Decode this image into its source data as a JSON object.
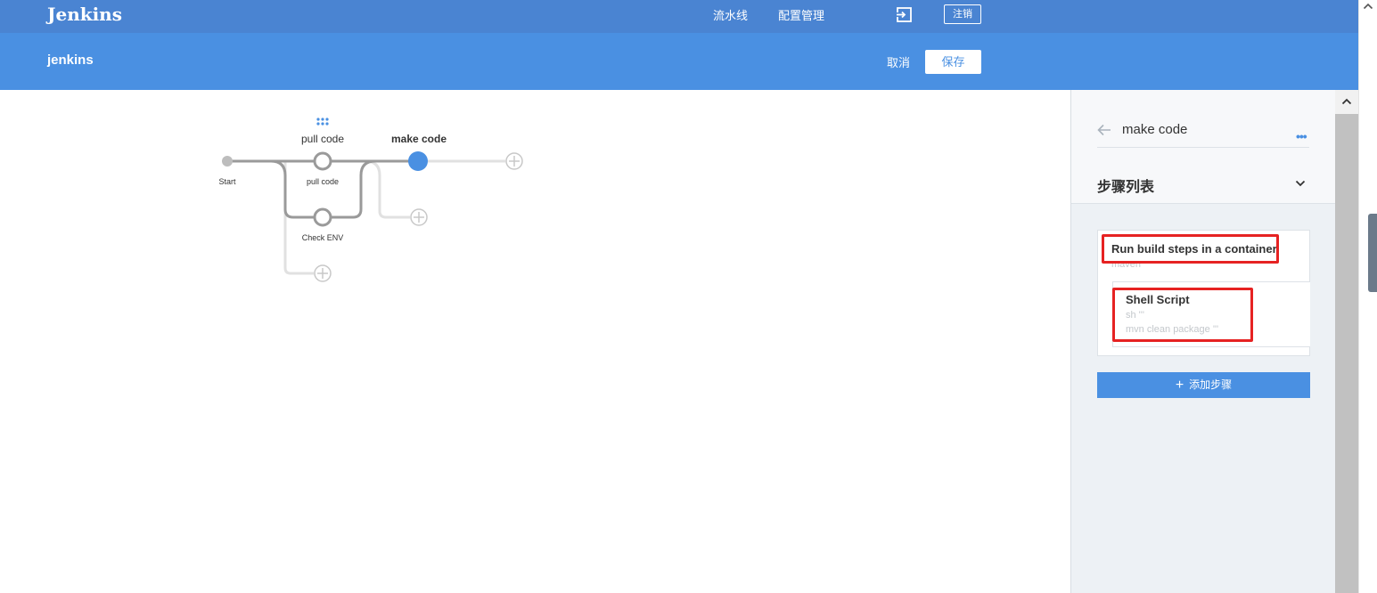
{
  "header": {
    "brand": "Jenkins",
    "nav": [
      "流水线",
      "配置管理"
    ],
    "logout": "注销"
  },
  "subheader": {
    "title": "jenkins",
    "cancel": "取消",
    "save": "保存"
  },
  "pipeline": {
    "start_label": "Start",
    "stages": [
      {
        "name": "pull code",
        "branches": [
          "pull code",
          "Check ENV"
        ]
      },
      {
        "name": "make code",
        "branches": []
      }
    ]
  },
  "panel": {
    "stage_name": "make code",
    "steps_title": "步骤列表",
    "steps": [
      {
        "title": "Run build steps in a container",
        "detail": "maven",
        "children": [
          {
            "title": "Shell Script",
            "line1": "sh '''",
            "line2": "mvn clean package '''"
          }
        ]
      }
    ],
    "add_step": "添加步骤"
  },
  "colors": {
    "topbar": "#4a84d2",
    "subbar": "#4a90e2",
    "highlight": "#e62222",
    "active_node": "#4a90e2"
  }
}
